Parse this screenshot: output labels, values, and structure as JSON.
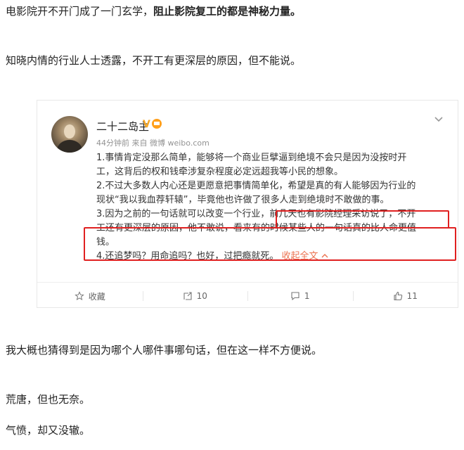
{
  "article": {
    "p1_normal": "电影院开不开门成了一门玄学，",
    "p1_bold": "阻止影院复工的都是神秘力量。",
    "p2": "知晓内情的行业人士透露，不开工有更深层的原因，但不能说。",
    "p3": "我大概也猜得到是因为哪个人哪件事哪句话，但在这一样不方便说。",
    "p4": "荒唐，但也无奈。",
    "p5": "气愤，却又没辙。"
  },
  "post": {
    "author": "二十二岛主",
    "verified_mark": "V",
    "meta": "44分钟前 来自 微博 weibo.com",
    "lines": [
      "1.事情肯定没那么简单，能够将一个商业巨擘逼到绝境不会只是因为没按时开",
      "工，这背后的权和钱牵涉复杂程度必定远超我等小民的想象。",
      "2.不过大多数人内心还是更愿意把事情简单化，希望是真的有人能够因为行业的",
      "现状“我以我血荐轩辕”，毕竟他也许做了很多人走到绝境时不敢做的事。",
      "3.因为之前的一句话就可以改变一个行业，前几天也有影院经理采访说了，不开",
      "工还有更深层的原因，他不敢说，看来有的时候某些人的一句话真的比人命更值",
      "钱。"
    ],
    "line8_text": "4.还追梦吗？用命追吗？也好，过把瘾就死。",
    "collapse_label": "收起全文",
    "actions": {
      "favorite": "收藏",
      "repost": "10",
      "comment": "1",
      "like": "11"
    }
  },
  "colors": {
    "highlight": "#e02020",
    "link": "#eb7350",
    "verified": "#f5a623"
  }
}
